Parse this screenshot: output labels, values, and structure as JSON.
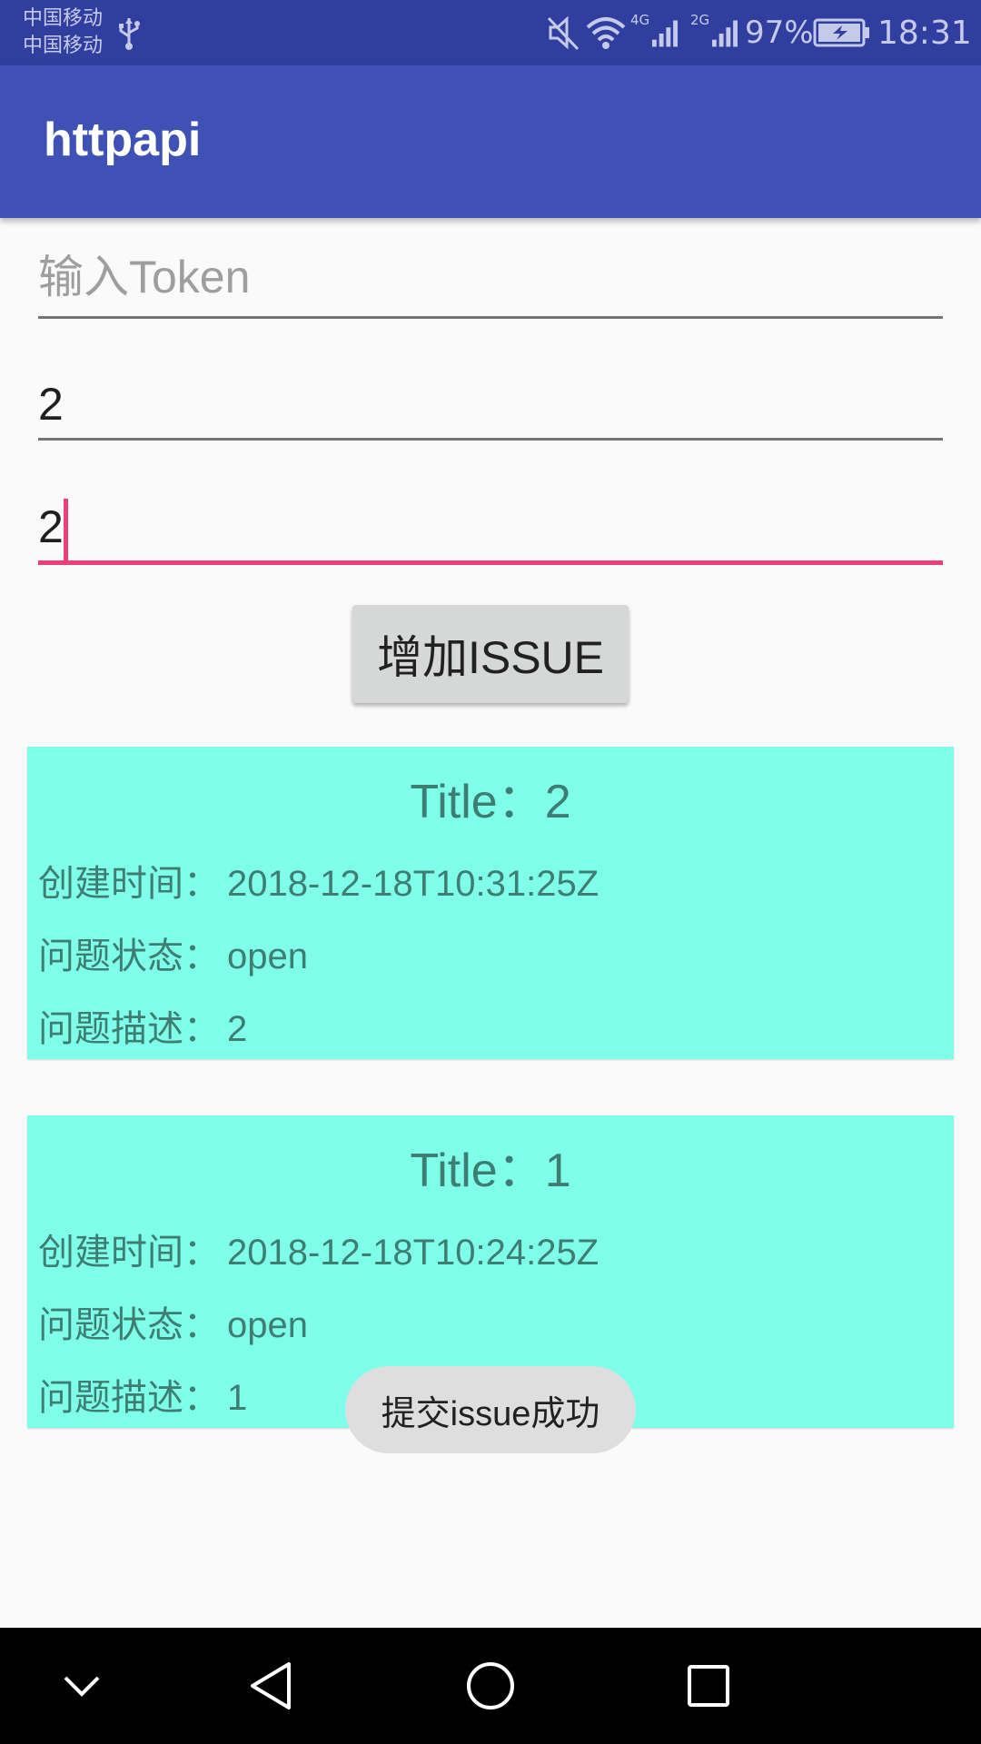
{
  "status_bar": {
    "carrier_1": "中国移动",
    "carrier_2": "中国移动",
    "network_1": "4G",
    "network_2": "2G",
    "battery": "97%",
    "time": "18:31"
  },
  "app_bar": {
    "title": "httpapi"
  },
  "form": {
    "token_placeholder": "输入Token",
    "token_value": "",
    "title_value": "2",
    "body_value": "2",
    "submit_label": "增加ISSUE"
  },
  "issues": [
    {
      "title_label": "Title：",
      "title": "2",
      "created_label": "创建时间：",
      "created": "2018-12-18T10:31:25Z",
      "state_label": "问题状态：",
      "state": "open",
      "desc_label": "问题描述：",
      "desc": "2"
    },
    {
      "title_label": "Title：",
      "title": "1",
      "created_label": "创建时间：",
      "created": "2018-12-18T10:24:25Z",
      "state_label": "问题状态：",
      "state": "open",
      "desc_label": "问题描述：",
      "desc": "1"
    }
  ],
  "toast": {
    "message": "提交issue成功"
  },
  "colors": {
    "status_bar": "#303f9f",
    "app_bar": "#3f51b5",
    "accent": "#ec407a",
    "card_bg": "#7fffea",
    "card_text": "#3e7d72"
  },
  "icons": {
    "usb": "usb-icon",
    "mute": "mute-icon",
    "wifi": "wifi-icon",
    "signal": "signal-icon",
    "battery": "battery-charging-icon",
    "nav_hide": "chevron-down-icon",
    "nav_back": "back-triangle-icon",
    "nav_home": "home-circle-icon",
    "nav_recents": "recents-square-icon"
  }
}
